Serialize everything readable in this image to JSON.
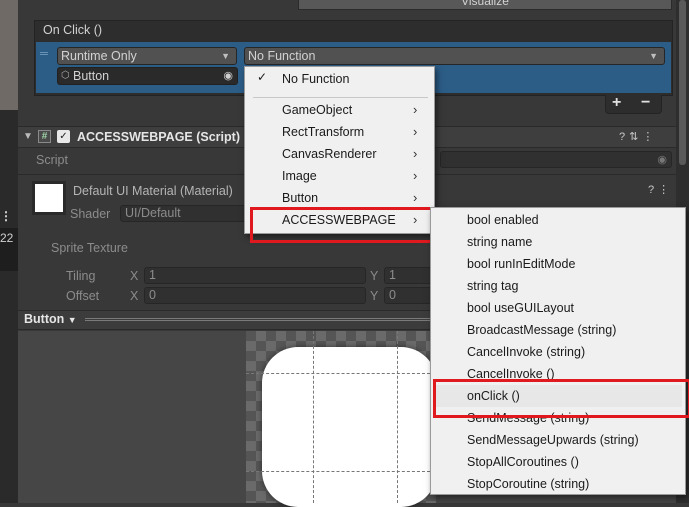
{
  "top_button": {
    "label": "Visualize"
  },
  "event": {
    "title": "On Click ()",
    "runtime": "Runtime Only",
    "function": "No Function",
    "object": "Button"
  },
  "component": {
    "title": "ACCESSWEBPAGE (Script)",
    "script_label": "Script"
  },
  "material": {
    "title": "Default UI Material (Material)",
    "shader_label": "Shader",
    "shader_value": "UI/Default",
    "side_number": "22",
    "sprite_texture_label": "Sprite Texture",
    "tiling_label": "Tiling",
    "offset_label": "Offset",
    "x_label": "X",
    "y_label": "Y",
    "tiling_x": "1",
    "tiling_y": "1",
    "offset_x": "0",
    "offset_y": "0"
  },
  "preview": {
    "title": "Button"
  },
  "menu_functions": {
    "items": [
      "No Function",
      "GameObject",
      "RectTransform",
      "CanvasRenderer",
      "Image",
      "Button",
      "ACCESSWEBPAGE"
    ],
    "checked": "No Function"
  },
  "menu_members": {
    "items": [
      "bool enabled",
      "string name",
      "bool runInEditMode",
      "string tag",
      "bool useGUILayout",
      "BroadcastMessage (string)",
      "CancelInvoke (string)",
      "CancelInvoke ()",
      "onClick ()",
      "SendMessage (string)",
      "SendMessageUpwards (string)",
      "StopAllCoroutines ()",
      "StopCoroutine (string)"
    ]
  },
  "colors": {
    "highlight": "#e0191f",
    "event_row": "#2c5d87",
    "menu_bg": "#f0f0f0"
  }
}
